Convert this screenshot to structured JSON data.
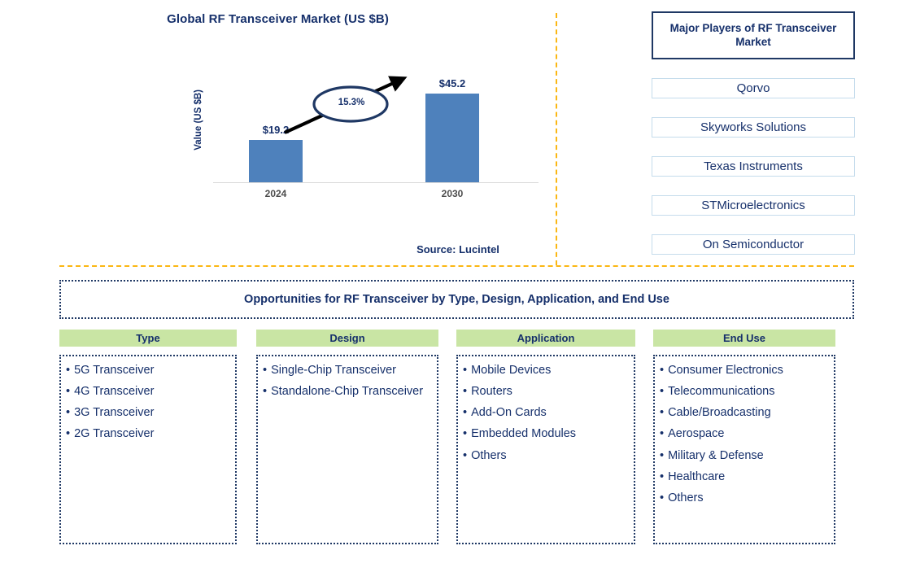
{
  "chart_data": {
    "type": "bar",
    "title": "Global RF Transceiver Market (US $B)",
    "xlabel": "",
    "ylabel": "Value (US $B)",
    "categories": [
      "2024",
      "2030"
    ],
    "values": [
      19.2,
      45.2
    ],
    "value_labels": [
      "$19.2",
      "$45.2"
    ],
    "ylim": [
      0,
      50
    ],
    "grid": false,
    "legend": "none",
    "annotations": [
      {
        "name": "cagr",
        "text": "15.3%",
        "type": "growth-arrow",
        "from": "2024",
        "to": "2030"
      }
    ],
    "bar_color": "#4E81BC",
    "source": "Source: Lucintel"
  },
  "chart": {
    "title": "Global RF Transceiver Market (US $B)",
    "y_axis_label": "Value (US $B)",
    "cagr": "15.3%",
    "bars": [
      {
        "category": "2024",
        "label": "$19.2"
      },
      {
        "category": "2030",
        "label": "$45.2"
      }
    ],
    "source": "Source: Lucintel"
  },
  "players": {
    "title": "Major Players of RF Transceiver Market",
    "items": [
      {
        "label": "Qorvo"
      },
      {
        "label": "Skyworks Solutions"
      },
      {
        "label": "Texas Instruments"
      },
      {
        "label": "STMicroelectronics"
      },
      {
        "label": "On Semiconductor"
      }
    ]
  },
  "opportunities": {
    "banner": "Opportunities for RF Transceiver by Type, Design, Application, and End Use",
    "bullet_glyph": "•",
    "columns": [
      {
        "header": "Type",
        "items": [
          "5G Transceiver",
          "4G Transceiver",
          "3G Transceiver",
          "2G Transceiver"
        ]
      },
      {
        "header": "Design",
        "items": [
          "Single-Chip Transceiver",
          "Standalone-Chip Transceiver"
        ]
      },
      {
        "header": "Application",
        "items": [
          "Mobile Devices",
          "Routers",
          "Add-On Cards",
          "Embedded Modules",
          "Others"
        ]
      },
      {
        "header": "End Use",
        "items": [
          "Consumer Electronics",
          "Telecommunications",
          "Cable/Broadcasting",
          "Aerospace",
          "Military & Defense",
          "Healthcare",
          "Others"
        ]
      }
    ]
  },
  "colors": {
    "bar": "#4E81BC",
    "navy_text": "#16306B",
    "header_green": "#C9E5A4",
    "divider_gold": "#FBB713",
    "player_border": "#C5DCEC"
  }
}
